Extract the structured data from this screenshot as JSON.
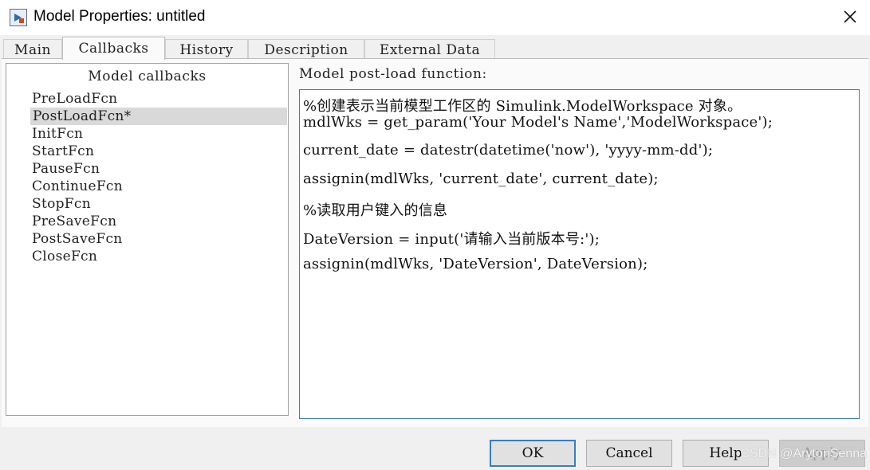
{
  "window": {
    "title": "Model Properties: untitled"
  },
  "tabs": [
    {
      "label": "Main"
    },
    {
      "label": "Callbacks"
    },
    {
      "label": "History"
    },
    {
      "label": "Description"
    },
    {
      "label": "External Data"
    }
  ],
  "callbacks": {
    "header": "Model callbacks",
    "items": [
      {
        "label": "PreLoadFcn"
      },
      {
        "label": "PostLoadFcn*"
      },
      {
        "label": "InitFcn"
      },
      {
        "label": "StartFcn"
      },
      {
        "label": "PauseFcn"
      },
      {
        "label": "ContinueFcn"
      },
      {
        "label": "StopFcn"
      },
      {
        "label": "PreSaveFcn"
      },
      {
        "label": "PostSaveFcn"
      },
      {
        "label": "CloseFcn"
      }
    ],
    "selected": "PostLoadFcn*"
  },
  "editor": {
    "label": "Model post-load function:",
    "lines": [
      "%创建表示当前模型工作区的 Simulink.ModelWorkspace 对象。",
      "mdlWks = get_param('Your Model's Name','ModelWorkspace');",
      "current_date = datestr(datetime('now'), 'yyyy-mm-dd');",
      "assignin(mdlWks, 'current_date', current_date);",
      "%读取用户键入的信息",
      "DateVersion = input('请输入当前版本号:');",
      "assignin(mdlWks, 'DateVersion', DateVersion);"
    ]
  },
  "buttons": {
    "ok": "OK",
    "cancel": "Cancel",
    "help": "Help",
    "apply": "Apply"
  },
  "watermark": "CSDN @ArytonSenna",
  "colors": {
    "accent": "#3a7cc2",
    "selected_row": "#d9d9d9"
  }
}
